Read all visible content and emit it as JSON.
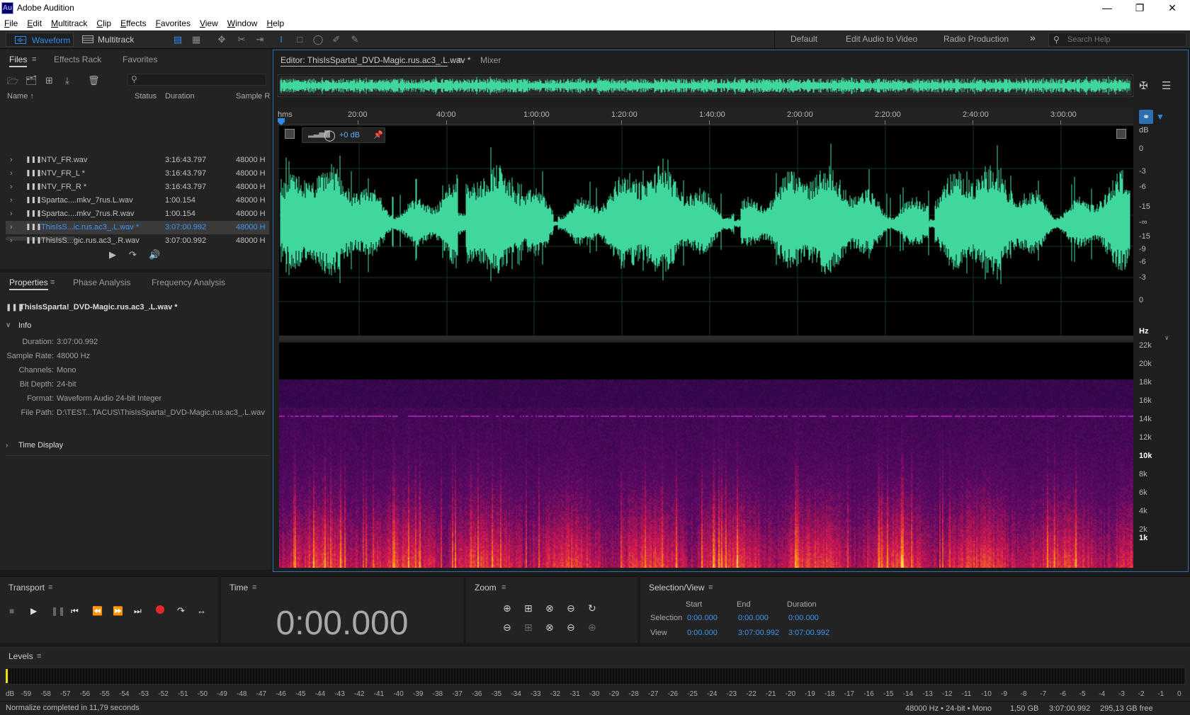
{
  "app": {
    "title": "Adobe Audition",
    "logo": "Au"
  },
  "menu": [
    "File",
    "Edit",
    "Multitrack",
    "Clip",
    "Effects",
    "Favorites",
    "View",
    "Window",
    "Help"
  ],
  "toolbar": {
    "waveform": "Waveform",
    "multitrack": "Multitrack",
    "workspaces": [
      "Default",
      "Edit Audio to Video",
      "Radio Production"
    ],
    "more": "»",
    "search_placeholder": "Search Help"
  },
  "files_panel": {
    "tabs": [
      "Files",
      "Effects Rack",
      "Favorites"
    ],
    "columns": {
      "name": "Name",
      "status": "Status",
      "duration": "Duration",
      "sample": "Sample R"
    },
    "rows": [
      {
        "name": "NTV_FR.wav",
        "duration": "3:16:43.797",
        "sample": "48000 H"
      },
      {
        "name": "NTV_FR_L *",
        "duration": "3:16:43.797",
        "sample": "48000 H"
      },
      {
        "name": "NTV_FR_R *",
        "duration": "3:16:43.797",
        "sample": "48000 H"
      },
      {
        "name": "Spartac....mkv_7rus.L.wav",
        "duration": "1:00.154",
        "sample": "48000 H"
      },
      {
        "name": "Spartac....mkv_7rus.R.wav",
        "duration": "1:00.154",
        "sample": "48000 H"
      },
      {
        "name": "ThisIsS...ic.rus.ac3_.L.wav *",
        "duration": "3:07:00.992",
        "sample": "48000 H"
      },
      {
        "name": "ThisIsS...gic.rus.ac3_.R.wav",
        "duration": "3:07:00.992",
        "sample": "48000 H"
      }
    ],
    "selected_index": 5
  },
  "properties_panel": {
    "tabs": [
      "Properties",
      "Phase Analysis",
      "Frequency Analysis"
    ],
    "file": "ThisIsSparta!_DVD-Magic.rus.ac3_.L.wav *",
    "info_label": "Info",
    "info": [
      {
        "k": "Duration:",
        "v": "3:07:00.992"
      },
      {
        "k": "Sample Rate:",
        "v": "48000 Hz"
      },
      {
        "k": "Channels:",
        "v": "Mono"
      },
      {
        "k": "Bit Depth:",
        "v": "24-bit"
      },
      {
        "k": "Format:",
        "v": "Waveform Audio 24-bit Integer"
      },
      {
        "k": "File Path:",
        "v": "D:\\TEST...TACUS\\ThisIsSparta!_DVD-Magic.rus.ac3_.L.wav"
      }
    ],
    "time_display": "Time Display"
  },
  "editor": {
    "tab": "Editor: ThisIsSparta!_DVD-Magic.rus.ac3_.L.wav *",
    "mixer": "Mixer",
    "gain": "+0 dB",
    "ruler": [
      "hms",
      "20:00",
      "40:00",
      "1:00:00",
      "1:20:00",
      "1:40:00",
      "2:00:00",
      "2:20:00",
      "2:40:00",
      "3:00:00"
    ],
    "db_scale": [
      "dB",
      "0",
      "-3",
      "-6",
      "-15",
      "-∞",
      "-15",
      "-9",
      "-6",
      "-3",
      "0"
    ],
    "hz_scale": [
      "Hz",
      "22k",
      "20k",
      "18k",
      "16k",
      "14k",
      "12k",
      "10k",
      "8k",
      "6k",
      "4k",
      "2k",
      "1k"
    ],
    "colors": {
      "wave": "#3fd79c",
      "spec_hot": "#ffd23c",
      "spec_low": "#2a0a4a"
    }
  },
  "transport": {
    "title": "Transport"
  },
  "time_panel": {
    "title": "Time",
    "value": "0:00.000"
  },
  "zoom": {
    "title": "Zoom"
  },
  "selection": {
    "title": "Selection/View",
    "headers": [
      "Start",
      "End",
      "Duration"
    ],
    "selection_label": "Selection",
    "view_label": "View",
    "selection": [
      "0:00.000",
      "0:00.000",
      "0:00.000"
    ],
    "view": [
      "0:00.000",
      "3:07:00.992",
      "3:07:00.992"
    ]
  },
  "levels": {
    "title": "Levels",
    "scale": [
      "dB",
      "-59",
      "-58",
      "-57",
      "-56",
      "-55",
      "-54",
      "-53",
      "-52",
      "-51",
      "-50",
      "-49",
      "-48",
      "-47",
      "-46",
      "-45",
      "-44",
      "-43",
      "-42",
      "-41",
      "-40",
      "-39",
      "-38",
      "-37",
      "-36",
      "-35",
      "-34",
      "-33",
      "-32",
      "-31",
      "-30",
      "-29",
      "-28",
      "-27",
      "-26",
      "-25",
      "-24",
      "-23",
      "-22",
      "-21",
      "-20",
      "-19",
      "-18",
      "-17",
      "-16",
      "-15",
      "-14",
      "-13",
      "-12",
      "-11",
      "-10",
      "-9",
      "-8",
      "-7",
      "-6",
      "-5",
      "-4",
      "-3",
      "-2",
      "-1",
      "0"
    ]
  },
  "status": {
    "left": "Normalize completed in 11,79 seconds",
    "format": "48000 Hz • 24-bit • Mono",
    "size": "1,50 GB",
    "duration": "3:07:00.992",
    "free": "295,13 GB free"
  }
}
